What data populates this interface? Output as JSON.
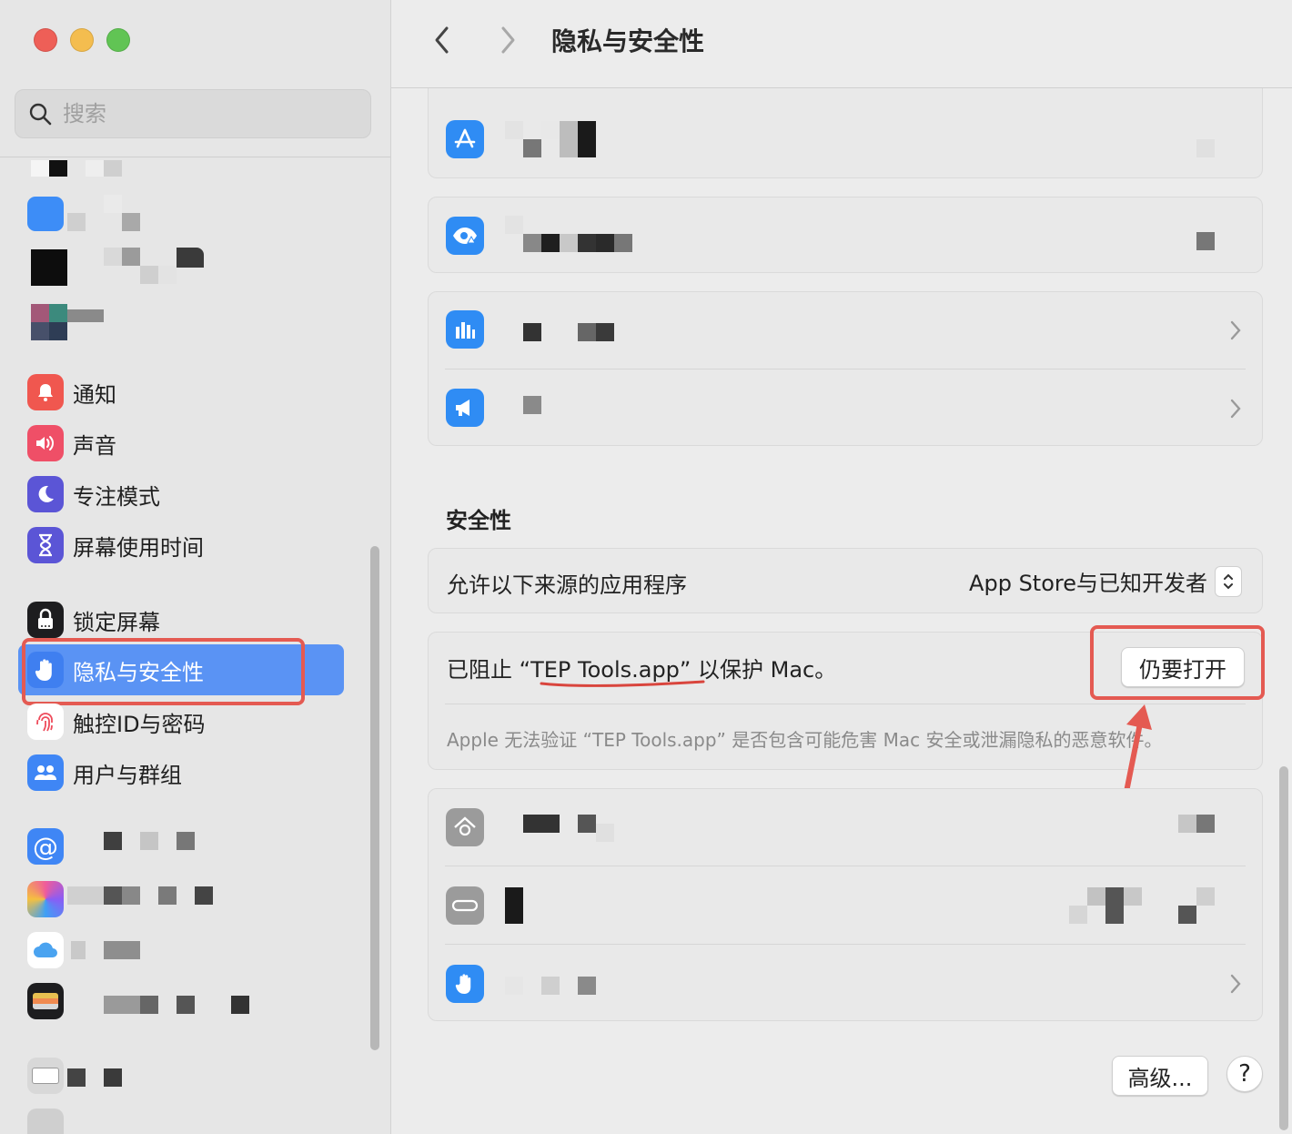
{
  "window": {
    "title": "隐私与安全性"
  },
  "search": {
    "placeholder": "搜索"
  },
  "sidebar": {
    "items": [
      {
        "label": "通知"
      },
      {
        "label": "声音"
      },
      {
        "label": "专注模式"
      },
      {
        "label": "屏幕使用时间"
      },
      {
        "label": "锁定屏幕"
      },
      {
        "label": "隐私与安全性"
      },
      {
        "label": "触控ID与密码"
      },
      {
        "label": "用户与群组"
      }
    ]
  },
  "security": {
    "section_title": "安全性",
    "allow_label": "允许以下来源的应用程序",
    "allow_value": "App Store与已知开发者",
    "blocked_prefix": "已阻止 “",
    "blocked_app": "TEP Tools.app",
    "blocked_suffix": "” 以保护 Mac。",
    "open_anyway_label": "仍要打开",
    "blocked_note": "Apple 无法验证 “TEP Tools.app” 是否包含可能危害 Mac 安全或泄漏隐私的恶意软件。"
  },
  "footer": {
    "advanced_label": "高级...",
    "help_label": "?"
  },
  "colors": {
    "accent": "#5a93f4",
    "highlight_box": "#e45a52"
  }
}
